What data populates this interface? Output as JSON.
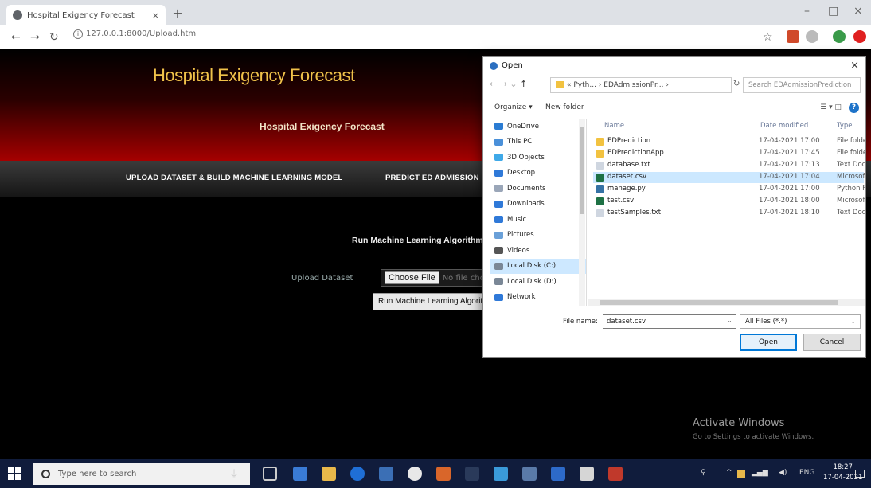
{
  "browser": {
    "tab_title": "Hospital Exigency Forecast",
    "tab_close": "×",
    "new_tab": "+",
    "url": "127.0.0.1:8000/Upload.html",
    "min": "–",
    "max": "□",
    "close": "×"
  },
  "page": {
    "hero_title": "Hospital Exigency Forecast",
    "hero_subtitle": "Hospital Exigency Forecast",
    "nav": [
      "UPLOAD DATASET & BUILD MACHINE LEARNING MODEL",
      "PREDICT ED ADMISSION"
    ],
    "form_heading": "Run Machine Learning Algorithm",
    "upload_label": "Upload Dataset",
    "choose_file": "Choose File",
    "no_file": "No file chosen",
    "run_button": "Run Machine Learning Algorithm"
  },
  "dialog": {
    "title": "Open",
    "close": "×",
    "path": "« Pyth... › EDAdmissionPr... ›",
    "search_placeholder": "Search EDAdmissionPrediction",
    "organize": "Organize ▾",
    "new_folder": "New folder",
    "sidebar": [
      {
        "label": "OneDrive",
        "color": "#2b7cd3"
      },
      {
        "label": "This PC",
        "color": "#4a90d9"
      },
      {
        "label": "3D Objects",
        "color": "#3fa9e8"
      },
      {
        "label": "Desktop",
        "color": "#2f79d8"
      },
      {
        "label": "Documents",
        "color": "#9aa6b8"
      },
      {
        "label": "Downloads",
        "color": "#2f79d8"
      },
      {
        "label": "Music",
        "color": "#2f79d8"
      },
      {
        "label": "Pictures",
        "color": "#6aa0d8"
      },
      {
        "label": "Videos",
        "color": "#555"
      },
      {
        "label": "Local Disk (C:)",
        "color": "#7a8796"
      },
      {
        "label": "Local Disk (D:)",
        "color": "#7a8796"
      },
      {
        "label": "Network",
        "color": "#2f79d8"
      }
    ],
    "columns": {
      "name": "Name",
      "date": "Date modified",
      "type": "Type"
    },
    "files": [
      {
        "name": "EDPrediction",
        "date": "17-04-2021 17:00",
        "type": "File folder",
        "color": "#f2c240"
      },
      {
        "name": "EDPredictionApp",
        "date": "17-04-2021 17:45",
        "type": "File folder",
        "color": "#f2c240"
      },
      {
        "name": "database.txt",
        "date": "17-04-2021 17:13",
        "type": "Text Document",
        "color": "#cfd6e0"
      },
      {
        "name": "dataset.csv",
        "date": "17-04-2021 17:04",
        "type": "Microsoft Excel",
        "color": "#1e7145"
      },
      {
        "name": "manage.py",
        "date": "17-04-2021 17:00",
        "type": "Python File",
        "color": "#3572a5"
      },
      {
        "name": "test.csv",
        "date": "17-04-2021 18:00",
        "type": "Microsoft Excel",
        "color": "#1e7145"
      },
      {
        "name": "testSamples.txt",
        "date": "17-04-2021 18:10",
        "type": "Text Document",
        "color": "#cfd6e0"
      }
    ],
    "selected_sidebar": "Local Disk (C:)",
    "selected_file": "dataset.csv",
    "filename_label": "File name:",
    "filename_value": "dataset.csv",
    "filetype": "All Files (*.*)",
    "open_button": "Open",
    "cancel_button": "Cancel"
  },
  "watermark": {
    "line1": "Activate Windows",
    "line2": "Go to Settings to activate Windows."
  },
  "taskbar": {
    "search_placeholder": "Type here to search",
    "time": "18:27",
    "date": "17-04-2021",
    "lang": "ENG"
  }
}
